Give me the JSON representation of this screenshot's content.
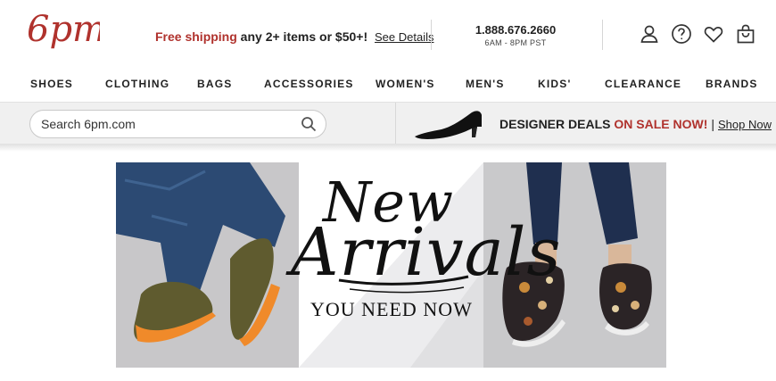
{
  "header": {
    "logo_text": "6pm",
    "promo": {
      "highlight": "Free shipping",
      "text": " any 2+ items or $50+!",
      "link": "See Details"
    },
    "phone": {
      "number": "1.888.676.2660",
      "hours": "6AM - 8PM PST"
    },
    "icons": [
      "account-icon",
      "help-icon",
      "favorites-heart-icon",
      "shopping-bag-icon"
    ]
  },
  "nav": {
    "items": [
      "SHOES",
      "CLOTHING",
      "BAGS",
      "ACCESSORIES",
      "WOMEN'S",
      "MEN'S",
      "KIDS'",
      "CLEARANCE",
      "BRANDS"
    ]
  },
  "search": {
    "placeholder": "Search 6pm.com"
  },
  "deal": {
    "dark_text": "DESIGNER DEALS ",
    "red_text": "ON SALE NOW!",
    "separator": "|",
    "link": "Shop Now"
  },
  "hero": {
    "script_line1": "New",
    "script_line2": "Arrivals",
    "tagline": "YOU NEED NOW"
  },
  "colors": {
    "brand_red": "#b0322d",
    "band_bg": "#f0f0f0"
  }
}
